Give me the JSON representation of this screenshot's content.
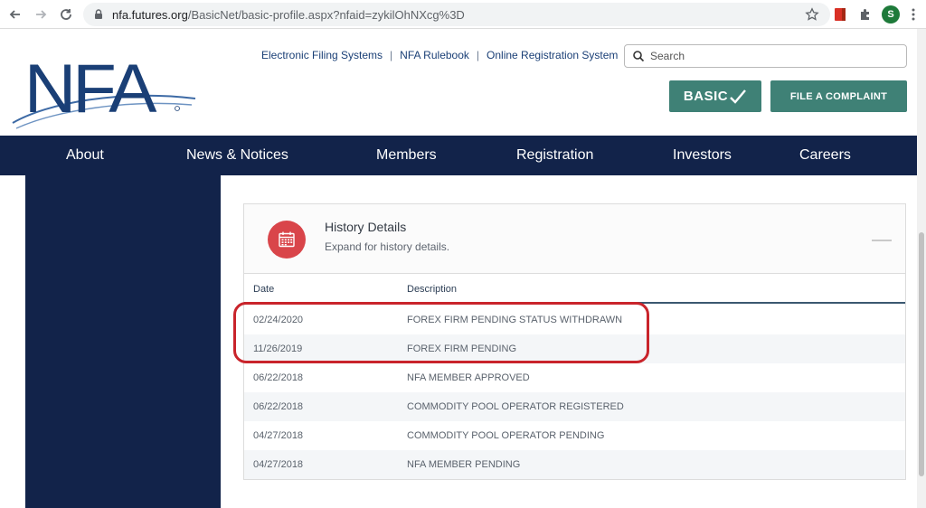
{
  "browser": {
    "url_host": "nfa.futures.org",
    "url_path": "/BasicNet/basic-profile.aspx?nfaid=zykilOhNXcg%3D",
    "profile_initial": "S"
  },
  "header": {
    "logo_alt": "NFA",
    "links": [
      {
        "label": "Electronic Filing Systems"
      },
      {
        "label": "NFA Rulebook"
      },
      {
        "label": "Online Registration System"
      }
    ],
    "separator": "|",
    "search_placeholder": "Search",
    "basic_button": "BASIC",
    "complaint_button": "FILE A COMPLAINT"
  },
  "nav": {
    "items": [
      {
        "label": "About"
      },
      {
        "label": "News & Notices"
      },
      {
        "label": "Members"
      },
      {
        "label": "Registration"
      },
      {
        "label": "Investors"
      },
      {
        "label": "Careers"
      }
    ]
  },
  "history": {
    "title": "History Details",
    "subtitle": "Expand for history details.",
    "col_date": "Date",
    "col_description": "Description",
    "rows": [
      {
        "date": "02/24/2020",
        "description": "FOREX FIRM PENDING STATUS WITHDRAWN"
      },
      {
        "date": "11/26/2019",
        "description": "FOREX FIRM PENDING"
      },
      {
        "date": "06/22/2018",
        "description": "NFA MEMBER APPROVED"
      },
      {
        "date": "06/22/2018",
        "description": "COMMODITY POOL OPERATOR REGISTERED"
      },
      {
        "date": "04/27/2018",
        "description": "COMMODITY POOL OPERATOR PENDING"
      },
      {
        "date": "04/27/2018",
        "description": "NFA MEMBER PENDING"
      }
    ]
  },
  "colors": {
    "navy": "#12234a",
    "teal_button": "#3f8176",
    "calendar_red": "#d9454a",
    "annotation_red": "#c9242b"
  }
}
